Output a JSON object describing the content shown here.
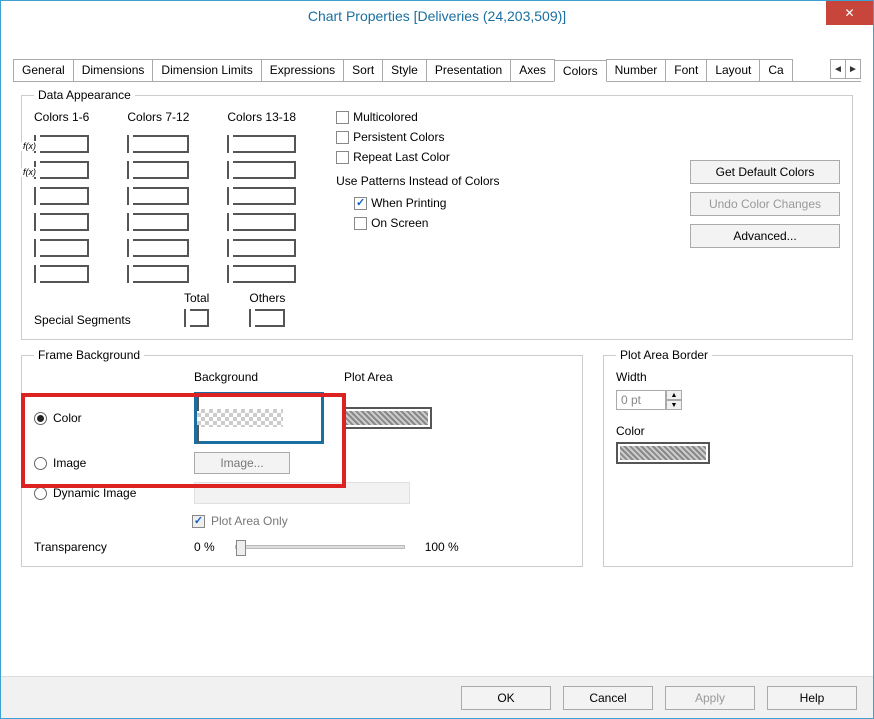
{
  "title": "Chart Properties [Deliveries (24,203,509)]",
  "tabs": [
    "General",
    "Dimensions",
    "Dimension Limits",
    "Expressions",
    "Sort",
    "Style",
    "Presentation",
    "Axes",
    "Colors",
    "Number",
    "Font",
    "Layout",
    "Ca"
  ],
  "active_tab": 8,
  "data_appearance": {
    "legend": "Data Appearance",
    "col_labels": [
      "Colors 1-6",
      "Colors 7-12",
      "Colors 13-18"
    ],
    "cols": [
      [
        {
          "color": "gradient-navy",
          "fx": true
        },
        {
          "color": "gray-grad",
          "fx": true
        },
        {
          "bg": "#b2d748"
        },
        {
          "bg": "#f6e22a"
        },
        {
          "bg": "#4dc0a3"
        },
        {
          "bg": "#d9ad86"
        }
      ],
      [
        {
          "bg": "#dd6bb0"
        },
        {
          "bg": "#b9b9b9"
        },
        {
          "bg": "#a7d7e4"
        },
        {
          "bg": "#9ed9bc"
        },
        {
          "bg": "#0f6d90"
        },
        {
          "bg": "#f6bcca"
        }
      ],
      [
        {
          "bg": "#4aa447"
        },
        {
          "bg": "#b596cc"
        },
        {
          "bg": "#a10f20"
        },
        {
          "bg": "#1aa6a0"
        },
        {
          "bg": "#c07a28"
        },
        {
          "bg": "#6b4a9b"
        }
      ]
    ],
    "special_label": "Special Segments",
    "total_label": "Total",
    "others_label": "Others",
    "total_color": "#e79738",
    "others_color": "#5a9be0",
    "checks": {
      "multicolored": "Multicolored",
      "persistent": "Persistent Colors",
      "repeat": "Repeat Last Color",
      "patterns_label": "Use Patterns Instead of Colors",
      "when_printing": "When Printing",
      "on_screen": "On Screen"
    },
    "buttons": {
      "get_default": "Get Default Colors",
      "undo": "Undo Color Changes",
      "advanced": "Advanced..."
    }
  },
  "frame_background": {
    "legend": "Frame Background",
    "background_label": "Background",
    "plot_area_label": "Plot Area",
    "color_radio": "Color",
    "image_radio": "Image",
    "dynamic_radio": "Dynamic Image",
    "image_btn": "Image...",
    "plot_area_only": "Plot Area Only",
    "transparency_label": "Transparency",
    "transparency_min": "0 %",
    "transparency_max": "100 %"
  },
  "plot_area_border": {
    "legend": "Plot Area Border",
    "width_label": "Width",
    "width_value": "0 pt",
    "color_label": "Color"
  },
  "dialog": {
    "ok": "OK",
    "cancel": "Cancel",
    "apply": "Apply",
    "help": "Help"
  }
}
